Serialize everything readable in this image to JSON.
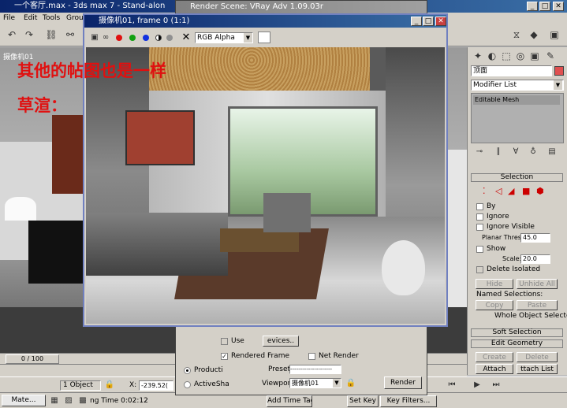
{
  "main_window": {
    "title": "一个客厅.max - 3ds max 7 - Stand-alon",
    "menus": [
      "File",
      "Edit",
      "Tools",
      "Group"
    ]
  },
  "render_scene": {
    "title": "Render Scene: VRay Adv 1.09.03r",
    "use_label": "Use",
    "devices_label": "evices..",
    "rendered_frame_label": "Rendered Frame",
    "net_render_label": "Net Render",
    "production_label": "Producti",
    "activeshade_label": "ActiveSha",
    "preset_label": "Preset:",
    "preset_value": "---------------------",
    "viewport_label": "Viewport:",
    "viewport_value": "摄像机01",
    "render_button": "Render"
  },
  "frame_window": {
    "title": "摄像机01, frame 0 (1:1)",
    "channel": "RGB Alpha",
    "overlay_line1": "其他的帖图也是一样",
    "overlay_line2": "草渲："
  },
  "viewport": {
    "label": "摄像机01"
  },
  "command_panel": {
    "object_name": "顶面",
    "modifier_list": "Modifier List",
    "stack_item": "Editable Mesh"
  },
  "selection_rollout": {
    "title": "Selection",
    "by": "By",
    "ignore": "Ignore",
    "ignore_visible": "Ignore Visible",
    "planar_thresh_label": "Planar Thresh:",
    "planar_thresh_value": "45.0",
    "show": "Show",
    "scale_label": "Scale:",
    "scale_value": "20.0",
    "delete_isolated": "Delete Isolated",
    "hide": "Hide",
    "unhide_all": "Unhide All",
    "named_selections": "Named Selections:",
    "copy": "Copy",
    "paste": "Paste",
    "whole_object": "Whole Object Selected"
  },
  "soft_selection": {
    "title": "Soft Selection"
  },
  "edit_geometry": {
    "title": "Edit Geometry",
    "create": "Create",
    "delete": "Delete",
    "attach": "Attach",
    "attach_list": "ttach List"
  },
  "timeline": {
    "frame": "0 / 100"
  },
  "status": {
    "selected": "1 Object",
    "x_label": "X:",
    "x_value": "-239.52(",
    "time": "ng Time  0:02:12",
    "add_time_tag": "Add Time Tag",
    "set_key": "Set Key",
    "key_filters": "Key Filters..."
  },
  "taskbar": {
    "max_button": "Mate..."
  },
  "colors": {
    "title_bar": "#0a246a",
    "overlay_text": "#e01010",
    "window_face": "#d4d0c8"
  }
}
